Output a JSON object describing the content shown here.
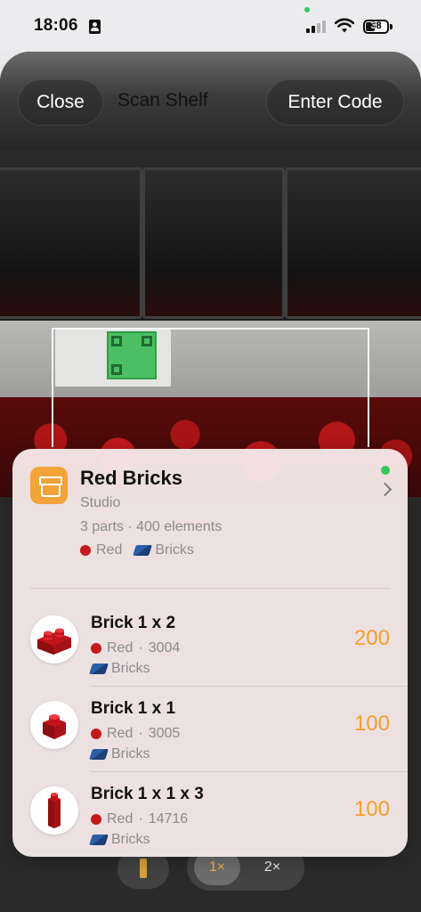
{
  "status_bar": {
    "time": "18:06",
    "battery_level": "38"
  },
  "header": {
    "close_label": "Close",
    "title": "Scan Shelf",
    "enter_code_label": "Enter Code"
  },
  "zoom": {
    "zoom_1x": "1×",
    "zoom_2x": "2×",
    "selected": "1×"
  },
  "bin": {
    "title": "Red Bricks",
    "subtitle": "Studio",
    "summary": "3 parts · 400 elements",
    "color_tag": "Red",
    "category_tag": "Bricks",
    "status_color": "#34c759"
  },
  "parts": [
    {
      "name": "Brick 1 x 2",
      "color": "Red",
      "number": "3004",
      "category": "Bricks",
      "quantity": "200"
    },
    {
      "name": "Brick 1 x 1",
      "color": "Red",
      "number": "3005",
      "category": "Bricks",
      "quantity": "100"
    },
    {
      "name": "Brick 1 x 1 x 3",
      "color": "Red",
      "number": "14716",
      "category": "Bricks",
      "quantity": "100"
    }
  ],
  "colors": {
    "accent_orange": "#f0a030",
    "brick_red": "#c41a1a",
    "bin_icon": "#f2a33a"
  },
  "icons": {
    "contact": "person-card-icon",
    "signal": "cellular-signal-icon",
    "wifi": "wifi-icon",
    "battery": "battery-icon",
    "bin": "archive-box-icon",
    "torch": "flashlight-icon",
    "chevron": "chevron-right-icon"
  }
}
